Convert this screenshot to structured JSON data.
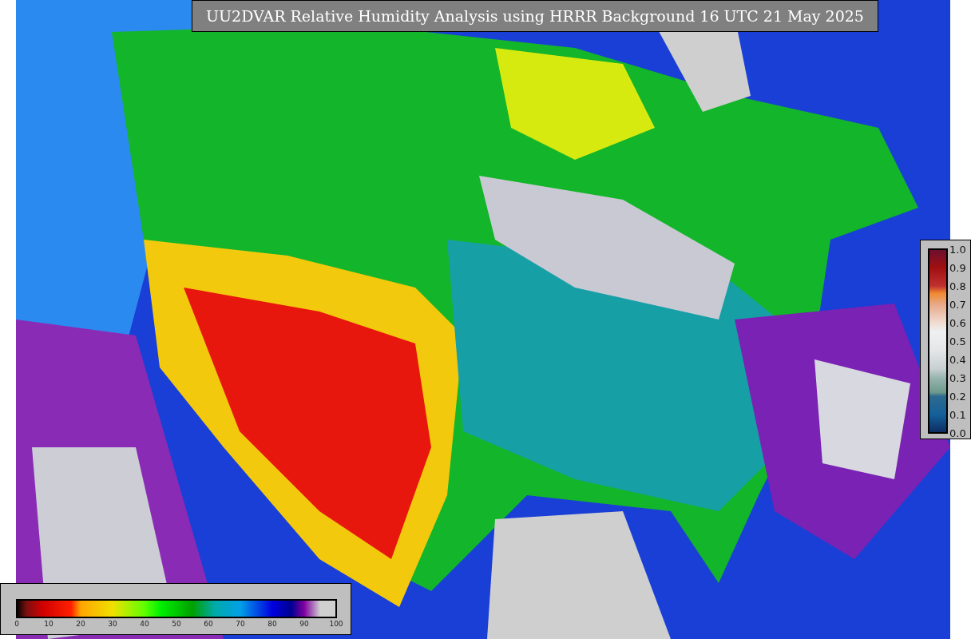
{
  "title": "UU2DVAR Relative Humidity Analysis using HRRR Background 16 UTC 21 May 2025",
  "humidity_colorbar": {
    "ticks": [
      "0",
      "10",
      "20",
      "30",
      "40",
      "50",
      "60",
      "70",
      "80",
      "90",
      "100"
    ]
  },
  "ratio_colorbar": {
    "ticks": [
      "1.0",
      "0.9",
      "0.8",
      "0.7",
      "0.6",
      "0.5",
      "0.4",
      "0.3",
      "0.2",
      "0.1",
      "0.0"
    ]
  }
}
